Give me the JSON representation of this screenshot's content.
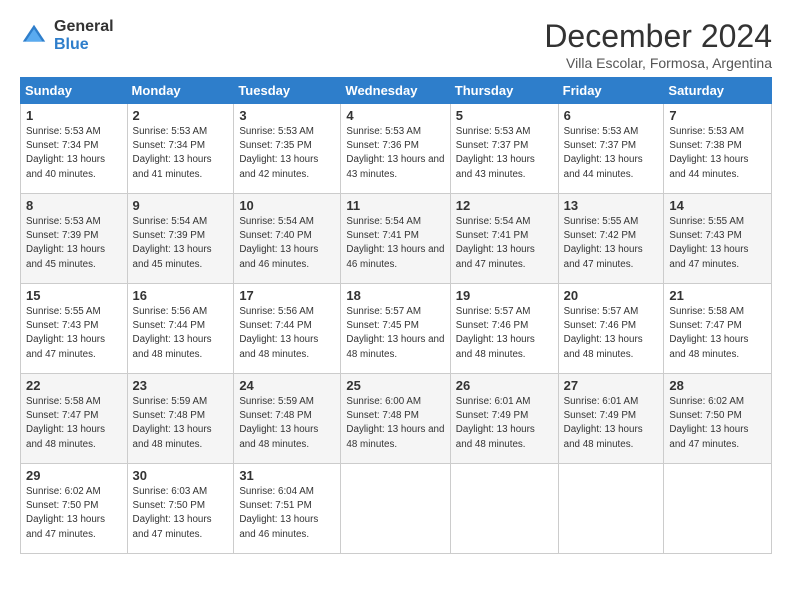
{
  "logo": {
    "general": "General",
    "blue": "Blue"
  },
  "title": "December 2024",
  "subtitle": "Villa Escolar, Formosa, Argentina",
  "days_of_week": [
    "Sunday",
    "Monday",
    "Tuesday",
    "Wednesday",
    "Thursday",
    "Friday",
    "Saturday"
  ],
  "weeks": [
    [
      {
        "day": "1",
        "sunrise": "5:53 AM",
        "sunset": "7:34 PM",
        "daylight": "13 hours and 40 minutes."
      },
      {
        "day": "2",
        "sunrise": "5:53 AM",
        "sunset": "7:34 PM",
        "daylight": "13 hours and 41 minutes."
      },
      {
        "day": "3",
        "sunrise": "5:53 AM",
        "sunset": "7:35 PM",
        "daylight": "13 hours and 42 minutes."
      },
      {
        "day": "4",
        "sunrise": "5:53 AM",
        "sunset": "7:36 PM",
        "daylight": "13 hours and 43 minutes."
      },
      {
        "day": "5",
        "sunrise": "5:53 AM",
        "sunset": "7:37 PM",
        "daylight": "13 hours and 43 minutes."
      },
      {
        "day": "6",
        "sunrise": "5:53 AM",
        "sunset": "7:37 PM",
        "daylight": "13 hours and 44 minutes."
      },
      {
        "day": "7",
        "sunrise": "5:53 AM",
        "sunset": "7:38 PM",
        "daylight": "13 hours and 44 minutes."
      }
    ],
    [
      {
        "day": "8",
        "sunrise": "5:53 AM",
        "sunset": "7:39 PM",
        "daylight": "13 hours and 45 minutes."
      },
      {
        "day": "9",
        "sunrise": "5:54 AM",
        "sunset": "7:39 PM",
        "daylight": "13 hours and 45 minutes."
      },
      {
        "day": "10",
        "sunrise": "5:54 AM",
        "sunset": "7:40 PM",
        "daylight": "13 hours and 46 minutes."
      },
      {
        "day": "11",
        "sunrise": "5:54 AM",
        "sunset": "7:41 PM",
        "daylight": "13 hours and 46 minutes."
      },
      {
        "day": "12",
        "sunrise": "5:54 AM",
        "sunset": "7:41 PM",
        "daylight": "13 hours and 47 minutes."
      },
      {
        "day": "13",
        "sunrise": "5:55 AM",
        "sunset": "7:42 PM",
        "daylight": "13 hours and 47 minutes."
      },
      {
        "day": "14",
        "sunrise": "5:55 AM",
        "sunset": "7:43 PM",
        "daylight": "13 hours and 47 minutes."
      }
    ],
    [
      {
        "day": "15",
        "sunrise": "5:55 AM",
        "sunset": "7:43 PM",
        "daylight": "13 hours and 47 minutes."
      },
      {
        "day": "16",
        "sunrise": "5:56 AM",
        "sunset": "7:44 PM",
        "daylight": "13 hours and 48 minutes."
      },
      {
        "day": "17",
        "sunrise": "5:56 AM",
        "sunset": "7:44 PM",
        "daylight": "13 hours and 48 minutes."
      },
      {
        "day": "18",
        "sunrise": "5:57 AM",
        "sunset": "7:45 PM",
        "daylight": "13 hours and 48 minutes."
      },
      {
        "day": "19",
        "sunrise": "5:57 AM",
        "sunset": "7:46 PM",
        "daylight": "13 hours and 48 minutes."
      },
      {
        "day": "20",
        "sunrise": "5:57 AM",
        "sunset": "7:46 PM",
        "daylight": "13 hours and 48 minutes."
      },
      {
        "day": "21",
        "sunrise": "5:58 AM",
        "sunset": "7:47 PM",
        "daylight": "13 hours and 48 minutes."
      }
    ],
    [
      {
        "day": "22",
        "sunrise": "5:58 AM",
        "sunset": "7:47 PM",
        "daylight": "13 hours and 48 minutes."
      },
      {
        "day": "23",
        "sunrise": "5:59 AM",
        "sunset": "7:48 PM",
        "daylight": "13 hours and 48 minutes."
      },
      {
        "day": "24",
        "sunrise": "5:59 AM",
        "sunset": "7:48 PM",
        "daylight": "13 hours and 48 minutes."
      },
      {
        "day": "25",
        "sunrise": "6:00 AM",
        "sunset": "7:48 PM",
        "daylight": "13 hours and 48 minutes."
      },
      {
        "day": "26",
        "sunrise": "6:01 AM",
        "sunset": "7:49 PM",
        "daylight": "13 hours and 48 minutes."
      },
      {
        "day": "27",
        "sunrise": "6:01 AM",
        "sunset": "7:49 PM",
        "daylight": "13 hours and 48 minutes."
      },
      {
        "day": "28",
        "sunrise": "6:02 AM",
        "sunset": "7:50 PM",
        "daylight": "13 hours and 47 minutes."
      }
    ],
    [
      {
        "day": "29",
        "sunrise": "6:02 AM",
        "sunset": "7:50 PM",
        "daylight": "13 hours and 47 minutes."
      },
      {
        "day": "30",
        "sunrise": "6:03 AM",
        "sunset": "7:50 PM",
        "daylight": "13 hours and 47 minutes."
      },
      {
        "day": "31",
        "sunrise": "6:04 AM",
        "sunset": "7:51 PM",
        "daylight": "13 hours and 46 minutes."
      },
      null,
      null,
      null,
      null
    ]
  ]
}
